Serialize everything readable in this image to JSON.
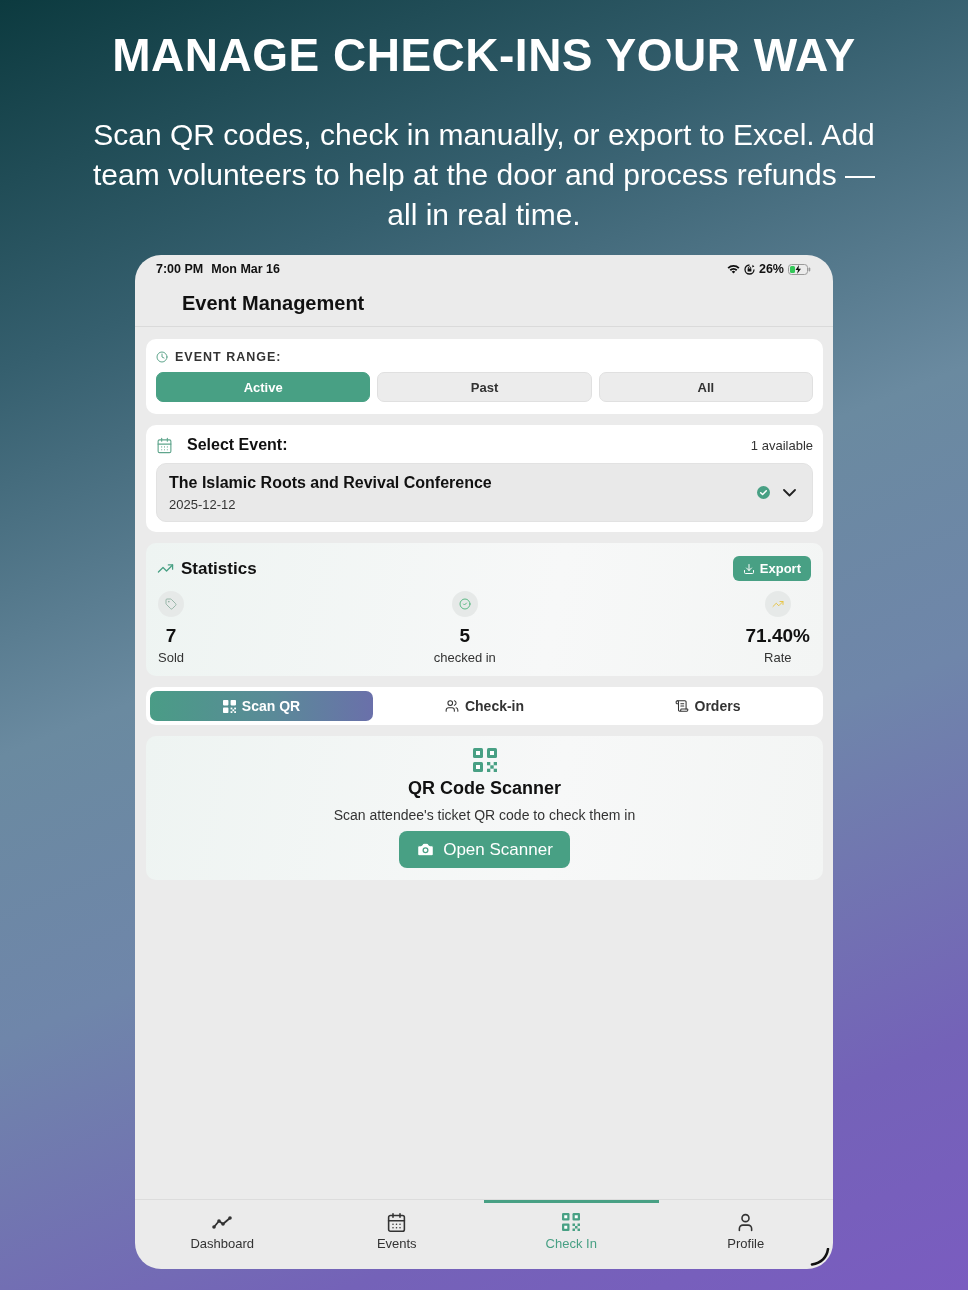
{
  "headline": "MANAGE CHECK-INS YOUR WAY",
  "subheadline": "Scan QR codes, check in manually, or export to Excel. Add team volunteers to help at the door and process refunds — all in real time.",
  "status_bar": {
    "time": "7:00 PM",
    "date": "Mon Mar 16",
    "battery": "26%"
  },
  "nav_bar": {
    "title": "Event Management"
  },
  "event_range": {
    "label": "EVENT RANGE:",
    "options": [
      {
        "label": "Active",
        "selected": true
      },
      {
        "label": "Past",
        "selected": false
      },
      {
        "label": "All",
        "selected": false
      }
    ]
  },
  "select_event": {
    "label": "Select Event:",
    "count": "1 available",
    "event": {
      "name": "The Islamic Roots and Revival Conference",
      "date": "2025-12-12",
      "verified": true
    }
  },
  "statistics": {
    "title": "Statistics",
    "export_button": "Export",
    "stats": [
      {
        "kind": "sold",
        "value": "7",
        "label": "Sold"
      },
      {
        "kind": "checked",
        "value": "5",
        "label": "checked in"
      },
      {
        "kind": "rate",
        "value": "71.40%",
        "label": "Rate"
      }
    ]
  },
  "mode_tabs": [
    {
      "kind": "qr",
      "label": "Scan QR",
      "selected": true
    },
    {
      "kind": "people",
      "label": "Check-in",
      "selected": false
    },
    {
      "kind": "orders",
      "label": "Orders",
      "selected": false
    }
  ],
  "scanner": {
    "title": "QR Code Scanner",
    "description": "Scan attendee's ticket QR code to check them in",
    "button": "Open Scanner"
  },
  "tab_bar": [
    {
      "kind": "dashboard",
      "label": "Dashboard",
      "selected": false
    },
    {
      "kind": "events",
      "label": "Events",
      "selected": false
    },
    {
      "kind": "checkin",
      "label": "Check In",
      "selected": true
    },
    {
      "kind": "profile",
      "label": "Profile",
      "selected": false
    }
  ]
}
